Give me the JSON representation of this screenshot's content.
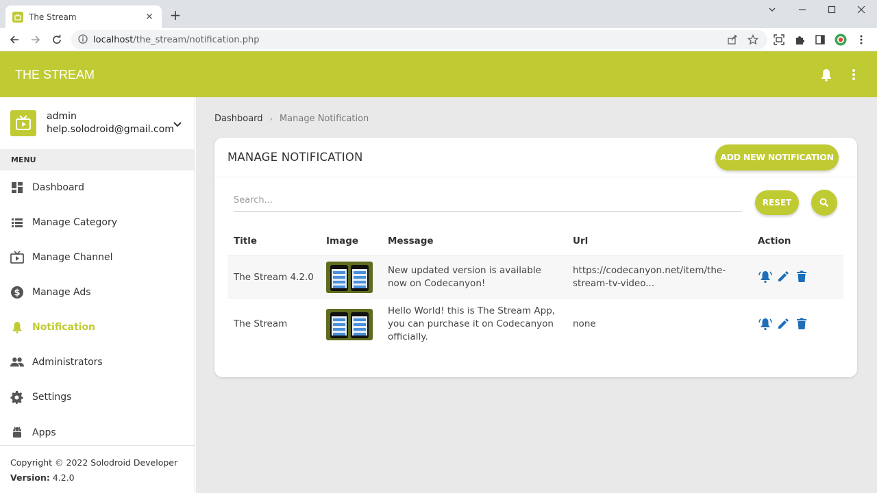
{
  "browser": {
    "tab_title": "The Stream",
    "url_host": "localhost",
    "url_path": "/the_stream/notification.php"
  },
  "app": {
    "title": "THE STREAM"
  },
  "user": {
    "name": "admin",
    "email": "help.solodroid@gmail.com"
  },
  "menu": {
    "header": "MENU",
    "items": [
      {
        "label": "Dashboard"
      },
      {
        "label": "Manage Category"
      },
      {
        "label": "Manage Channel"
      },
      {
        "label": "Manage Ads"
      },
      {
        "label": "Notification"
      },
      {
        "label": "Administrators"
      },
      {
        "label": "Settings"
      },
      {
        "label": "Apps"
      }
    ]
  },
  "footer": {
    "copyright": "Copyright © 2022 Solodroid Developer",
    "version_label": "Version:",
    "version_value": "4.2.0"
  },
  "breadcrumb": {
    "home": "Dashboard",
    "current": "Manage Notification"
  },
  "card": {
    "title": "MANAGE NOTIFICATION",
    "add_button": "ADD NEW NOTIFICATION",
    "search_placeholder": "Search...",
    "reset_button": "RESET"
  },
  "table": {
    "columns": [
      "Title",
      "Image",
      "Message",
      "Url",
      "Action"
    ],
    "rows": [
      {
        "title": "The Stream 4.2.0",
        "message": "New updated version is available now on Codecanyon!",
        "url": "https://codecanyon.net/item/the-stream-tv-video..."
      },
      {
        "title": "The Stream",
        "message": "Hello World! this is The Stream App, you can purchase it on Codecanyon officially.",
        "url": "none"
      }
    ]
  },
  "colors": {
    "accent": "#c0ca33",
    "action_icon": "#1e6fb8"
  }
}
